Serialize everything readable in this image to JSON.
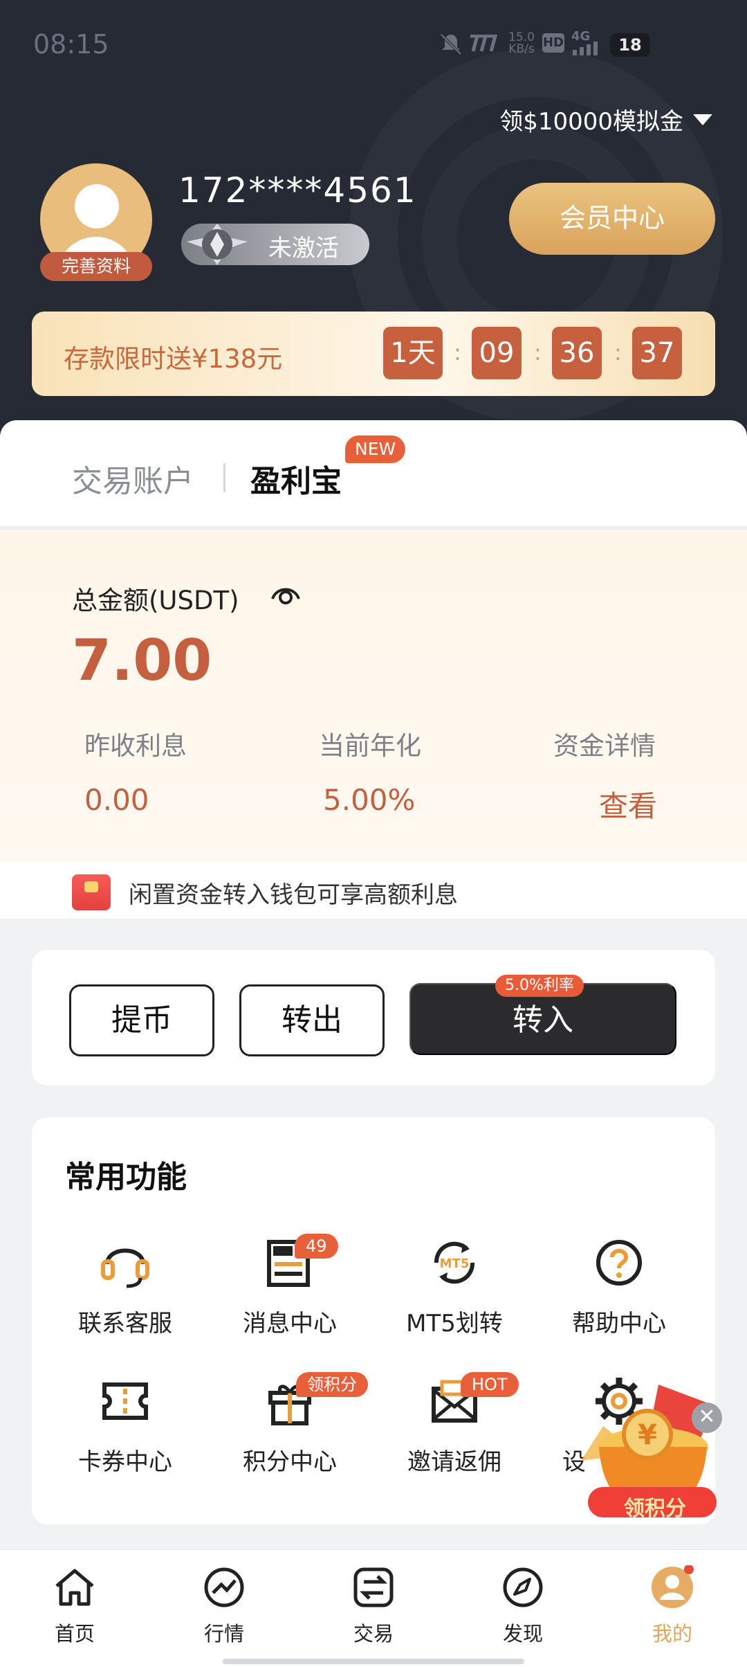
{
  "status_bar": {
    "time": "08:15",
    "net_speed": "15.0\nKB/s",
    "hd": "HD",
    "network": "4G",
    "battery": "18"
  },
  "header": {
    "promo_link": "领$10000模拟金",
    "user_phone": "172****4561",
    "avatar_tag": "完善资料",
    "level_status": "未激活",
    "vip_button": "会员中心",
    "deposit_promo": {
      "text": "存款限时送¥138元",
      "days": "1天",
      "hours": "09",
      "minutes": "36",
      "seconds": "37",
      "sep": ":"
    }
  },
  "tabs": [
    {
      "label": "交易账户"
    },
    {
      "label": "盈利宝",
      "badge": "NEW"
    }
  ],
  "asset": {
    "total_label": "总金额(USDT)",
    "total_value": "7.00",
    "stats": [
      {
        "label": "昨收利息",
        "value": "0.00"
      },
      {
        "label": "当前年化",
        "value": "5.00%"
      },
      {
        "label": "资金详情",
        "value": "查看"
      }
    ],
    "tip": "闲置资金转入钱包可享高额利息"
  },
  "actions": {
    "withdraw": "提币",
    "transfer_out": "转出",
    "transfer_in": "转入",
    "rate_badge": "5.0%利率"
  },
  "functions": {
    "title": "常用功能",
    "items": [
      {
        "label": "联系客服",
        "icon": "headset-icon"
      },
      {
        "label": "消息中心",
        "icon": "news-icon",
        "badge": "49"
      },
      {
        "label": "MT5划转",
        "icon": "mt5-transfer-icon"
      },
      {
        "label": "帮助中心",
        "icon": "help-icon"
      },
      {
        "label": "卡券中心",
        "icon": "ticket-icon"
      },
      {
        "label": "积分中心",
        "icon": "gift-icon",
        "badge": "领积分"
      },
      {
        "label": "邀请返佣",
        "icon": "invite-mail-icon",
        "badge": "HOT"
      },
      {
        "label": "设",
        "icon": "gear-icon"
      }
    ]
  },
  "float_promo": {
    "label": "领积分",
    "close": "✕"
  },
  "bottom_nav": [
    {
      "label": "首页",
      "icon": "home-icon"
    },
    {
      "label": "行情",
      "icon": "market-icon"
    },
    {
      "label": "交易",
      "icon": "trade-icon"
    },
    {
      "label": "发现",
      "icon": "compass-icon"
    },
    {
      "label": "我的",
      "icon": "profile-icon",
      "active": true
    }
  ],
  "colors": {
    "accent": "#c4603f",
    "gold": "#e2a55b",
    "header_bg": "#262a35"
  }
}
